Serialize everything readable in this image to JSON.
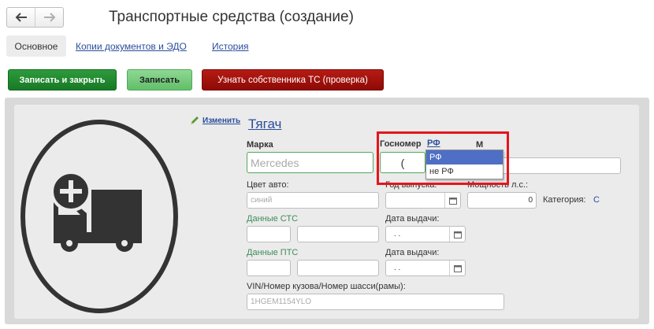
{
  "header": {
    "back_icon": "arrow-left-icon",
    "forward_icon": "arrow-right-icon",
    "title": "Транспортные средства (создание)"
  },
  "tabs": [
    {
      "label": "Основное",
      "active": true
    },
    {
      "label": "Копии документов и ЭДО",
      "active": false
    },
    {
      "label": "История",
      "active": false
    }
  ],
  "toolbar": {
    "save_close": "Записать и закрыть",
    "save": "Записать",
    "check_owner": "Узнать собственника ТС (проверка)"
  },
  "form": {
    "edit_label": "Изменить",
    "section_title": "Тягач",
    "brand_label": "Марка",
    "brand_placeholder": "Mercedes",
    "plate_label": "Госномер",
    "plate_country_value": "РФ",
    "plate_partial_value": "(",
    "model_label_partial": "М",
    "color_label": "Цвет авто:",
    "color_placeholder": "синий",
    "year_label": "Год выпуска:",
    "power_label": "Мощность л.с.:",
    "power_value": "0",
    "category_label": "Категория:",
    "category_value": "С",
    "sts_label": "Данные СТС",
    "sts_date_label": "Дата выдачи:",
    "sts_date_value": ". .",
    "pts_label": "Данные ПТС",
    "pts_date_label": "Дата выдачи:",
    "pts_date_value": ". .",
    "vin_label": "VIN/Номер кузова/Номер шасси(рамы):",
    "vin_placeholder": "1HGEM1154YLO"
  },
  "dropdown": {
    "options": [
      "РФ",
      "не РФ"
    ],
    "selected": "РФ"
  },
  "colors": {
    "link": "#2a4d9b",
    "green_button": "#177a25",
    "light_green_button": "#61bf69",
    "red_button": "#8e0a06",
    "highlight": "#e4161c"
  },
  "image_icon": "add-truck-icon"
}
